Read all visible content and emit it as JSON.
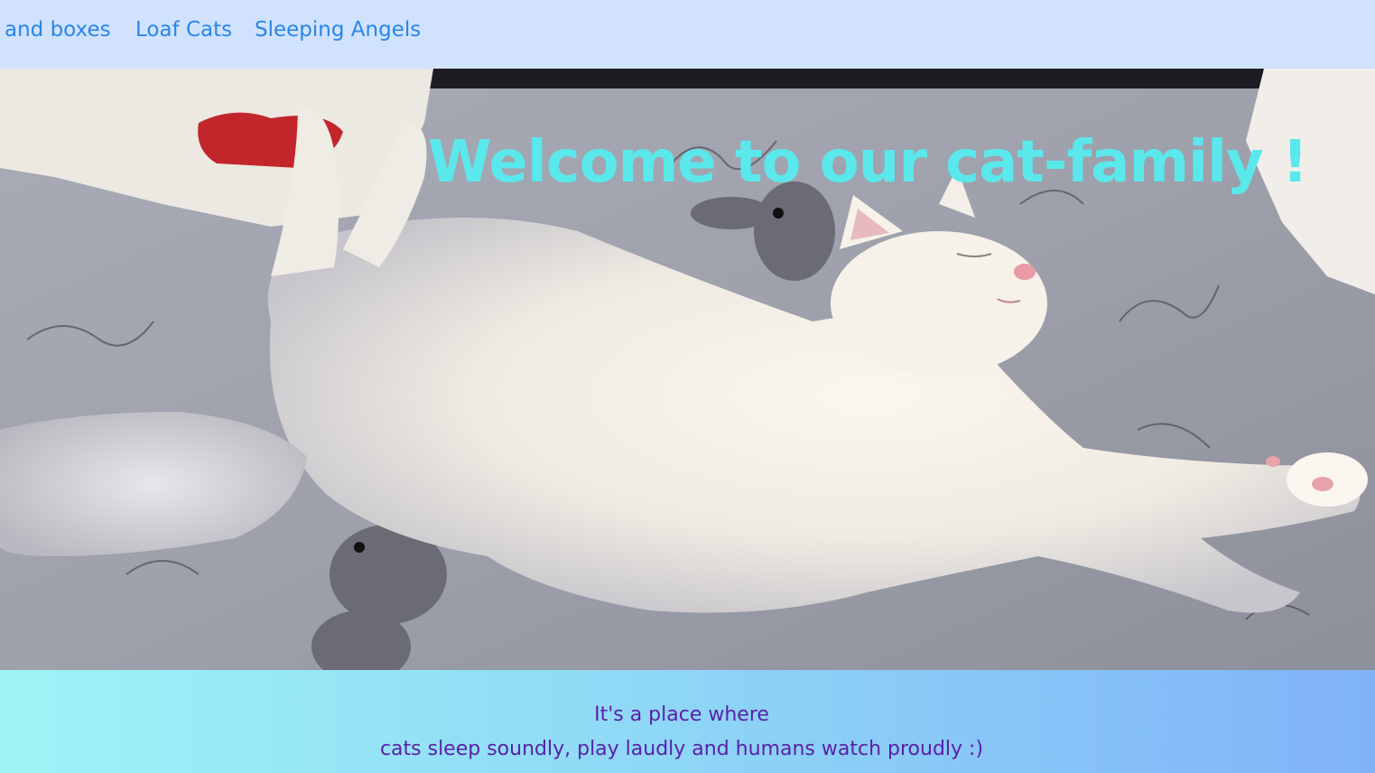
{
  "nav": {
    "links": [
      {
        "label": "and boxes"
      },
      {
        "label": "Loaf Cats"
      },
      {
        "label": "Sleeping Angels"
      }
    ]
  },
  "hero": {
    "title": "Welcome to our cat-family !",
    "image_subject": "white cat sleeping stretched out on a grey floral blanket with rabbit prints"
  },
  "footer": {
    "line1": "It's a place where",
    "line2": "cats sleep soundly, play laudly and humans watch proudly :)"
  },
  "colors": {
    "nav_background": "#d0e2fe",
    "nav_link": "#2a86e3",
    "title": "#5ae8ec",
    "tagline": "#5a1fa8",
    "footer_gradient_start": "#9ef4f6",
    "footer_gradient_end": "#80b2f8"
  }
}
